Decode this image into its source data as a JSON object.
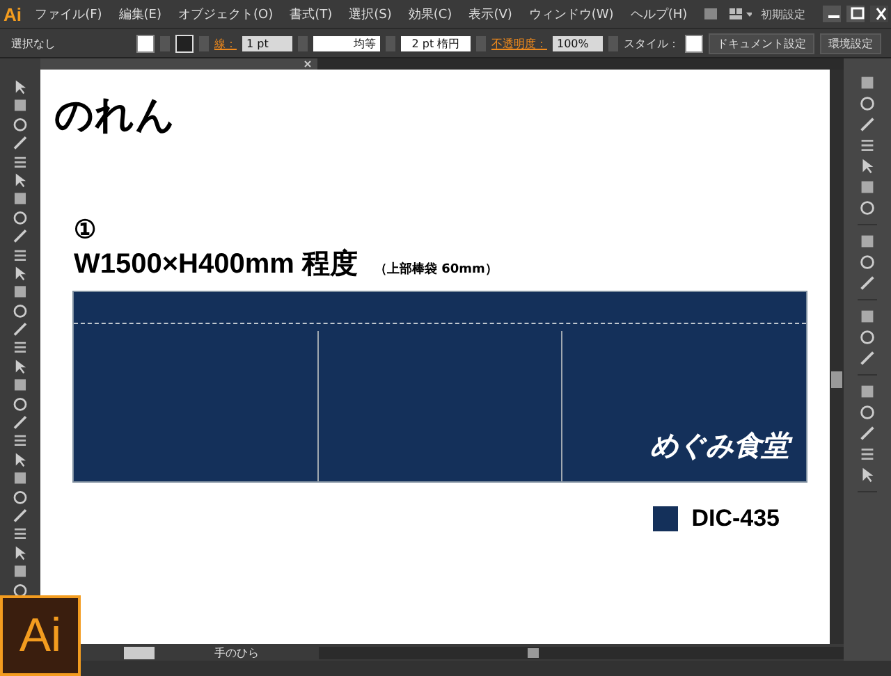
{
  "app": {
    "logo": "Ai",
    "workspace": "初期設定"
  },
  "menu": [
    "ファイル(F)",
    "編集(E)",
    "オブジェクト(O)",
    "書式(T)",
    "選択(S)",
    "効果(C)",
    "表示(V)",
    "ウィンドウ(W)",
    "ヘルプ(H)"
  ],
  "control_bar": {
    "selection": "選択なし",
    "stroke_label": "線：",
    "stroke_weight": "1 pt",
    "stroke_profile": "均等",
    "brush": "2 pt 楕円",
    "opacity_label": "不透明度：",
    "opacity": "100%",
    "style_label": "スタイル：",
    "buttons": [
      "ドキュメント設定",
      "環境設定"
    ]
  },
  "document": {
    "heading": "のれん",
    "number": "①",
    "size": "W1500×H400mm 程度",
    "note": "（上部棒袋 60mm）",
    "banner_text": "めぐみ食堂",
    "swatch_label": "DIC-435"
  },
  "status_bar": {
    "tool": "手のひら"
  },
  "badge": "Ai"
}
